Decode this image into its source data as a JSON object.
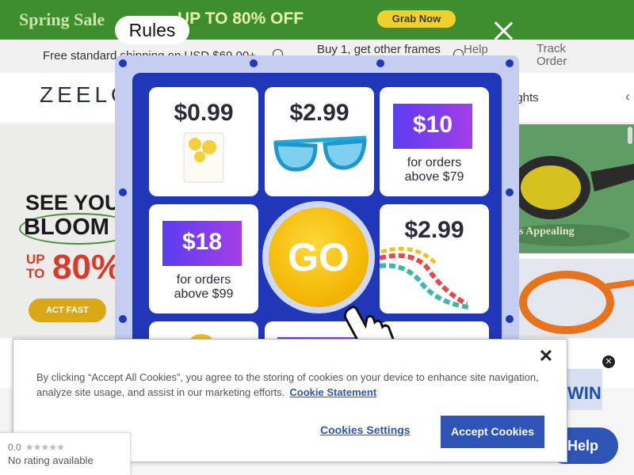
{
  "promo": {
    "title": "Spring Sale",
    "discount": "UP TO 80% OFF",
    "cta": "Grab Now"
  },
  "info_bar": {
    "shipping": "Free standard shipping on USD $69.00+",
    "buy": "Buy 1, get other frames",
    "help": "Help",
    "track": "Track Order"
  },
  "nav": {
    "logo": "ZEELOOL",
    "item": "ights"
  },
  "hero": {
    "line1": "SEE YOU",
    "line2": "BLOOM",
    "upto": "UP TO",
    "percent": "80%",
    "cta": "ACT FAST",
    "caption": "s Appealing"
  },
  "popup": {
    "rules": "Rules",
    "tiles": [
      {
        "price": "$0.99"
      },
      {
        "price": "$2.99"
      },
      {
        "coupon": "$10",
        "note": "for orders above $79"
      },
      {
        "coupon": "$18",
        "note": "for orders above $99"
      },
      {
        "price": "$2.99"
      }
    ],
    "go": "GO"
  },
  "cookie": {
    "text": "By clicking “Accept All Cookies”, you agree to the storing of cookies on your device to enhance site navigation, analyze site usage, and assist in our marketing efforts.",
    "link": "Cookie Statement",
    "settings": "Cookies Settings",
    "accept": "Accept Cookies"
  },
  "rating": {
    "score": "0.0",
    "stars": "★★★★★",
    "label": "No rating available"
  },
  "widgets": {
    "win": "WIN",
    "help": "Help"
  },
  "colors": {
    "promo_green": "#3e8e2f",
    "board_blue": "#1f37b8",
    "accent_blue": "#2e54b8",
    "go_yellow": "#f2b400"
  },
  "icons": [
    "info-icon",
    "close-icon",
    "chevron-left-icon",
    "pointer-hand-icon",
    "star-icon"
  ]
}
